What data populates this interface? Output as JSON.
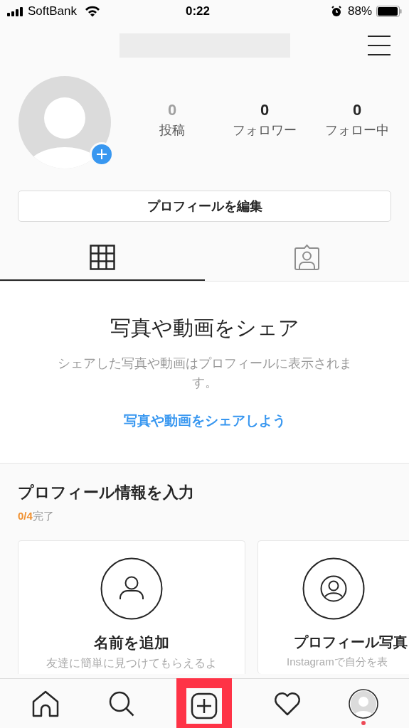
{
  "status_bar": {
    "carrier": "SoftBank",
    "time": "0:22",
    "battery": "88%"
  },
  "stats": [
    {
      "value": "0",
      "label": "投稿",
      "muted": true
    },
    {
      "value": "0",
      "label": "フォロワー",
      "muted": false
    },
    {
      "value": "0",
      "label": "フォロー中",
      "muted": false
    }
  ],
  "edit_button": "プロフィールを編集",
  "tabs": [
    {
      "kind": "grid",
      "selected": true
    },
    {
      "kind": "tagged",
      "selected": false
    }
  ],
  "empty_state": {
    "title": "写真や動画をシェア",
    "description": "シェアした写真や動画はプロフィールに表示されます。",
    "link": "写真や動画をシェアしよう"
  },
  "profile_setup": {
    "title": "プロフィール情報を入力",
    "progress": "0/4",
    "progress_suffix": "完了",
    "cards": [
      {
        "kind": "name",
        "title": "名前を追加",
        "description": "友達に簡単に見つけてもらえるよ"
      },
      {
        "kind": "photo",
        "title": "プロフィール写真",
        "description": "Instagramで自分を表"
      }
    ]
  },
  "nav": [
    {
      "kind": "home",
      "highlighted": false,
      "badge": false
    },
    {
      "kind": "search",
      "highlighted": false,
      "badge": false
    },
    {
      "kind": "add",
      "highlighted": true,
      "badge": false
    },
    {
      "kind": "heart",
      "highlighted": false,
      "badge": false
    },
    {
      "kind": "profile",
      "highlighted": false,
      "badge": true
    }
  ]
}
